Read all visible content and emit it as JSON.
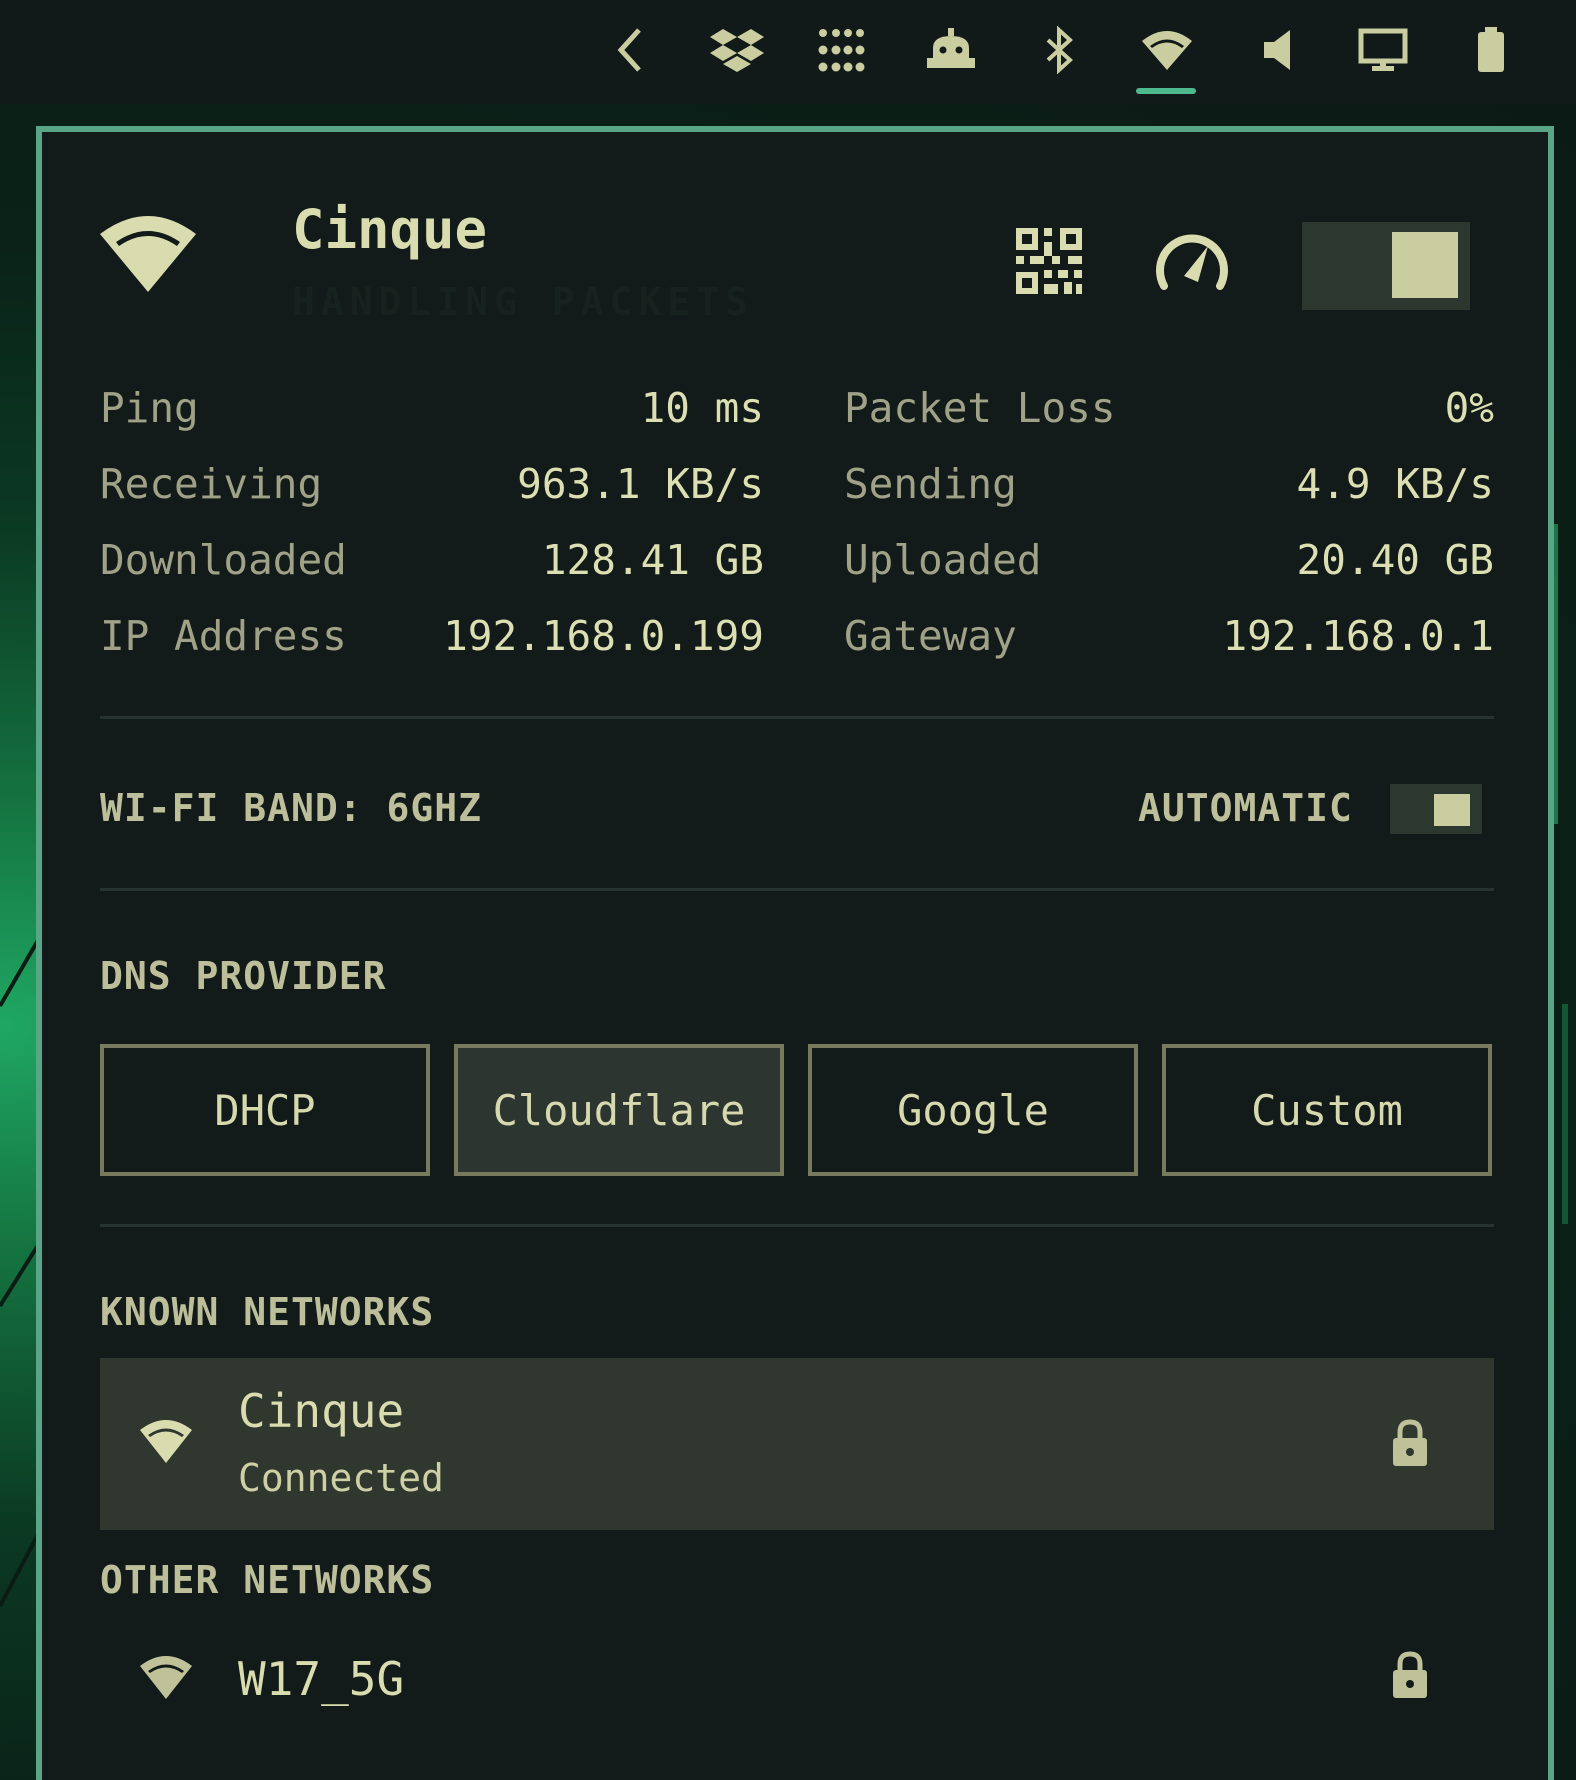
{
  "topbar": {
    "icons": [
      "chevron-left-icon",
      "dropbox-icon",
      "apps-grid-icon",
      "robot-icon",
      "bluetooth-icon",
      "wifi-icon",
      "volume-icon",
      "display-icon",
      "battery-icon"
    ],
    "active": "wifi-icon"
  },
  "header": {
    "network_name": "Cinque",
    "status_text": "HANDLING PACKETS",
    "toggle_on": true
  },
  "stats": {
    "left": [
      {
        "label": "Ping",
        "value": "10 ms"
      },
      {
        "label": "Receiving",
        "value": "963.1 KB/s"
      },
      {
        "label": "Downloaded",
        "value": "128.41 GB"
      },
      {
        "label": "IP Address",
        "value": "192.168.0.199"
      }
    ],
    "right": [
      {
        "label": "Packet Loss",
        "value": "0%"
      },
      {
        "label": "Sending",
        "value": "4.9 KB/s"
      },
      {
        "label": "Uploaded",
        "value": "20.40 GB"
      },
      {
        "label": "Gateway",
        "value": "192.168.0.1"
      }
    ]
  },
  "band": {
    "label": "WI-FI BAND: 6GHZ",
    "automatic_label": "AUTOMATIC",
    "automatic_on": true
  },
  "dns": {
    "section_label": "DNS PROVIDER",
    "options": [
      "DHCP",
      "Cloudflare",
      "Google",
      "Custom"
    ],
    "selected": "Cloudflare"
  },
  "known_networks": {
    "section_label": "KNOWN NETWORKS",
    "items": [
      {
        "name": "Cinque",
        "status": "Connected",
        "secured": true
      }
    ]
  },
  "other_networks": {
    "section_label": "OTHER NETWORKS",
    "items": [
      {
        "name": "W17_5G",
        "secured": true
      }
    ]
  },
  "colors": {
    "accent": "#5aa487",
    "text": "#d9dcae",
    "panel_bg": "#121b19",
    "selected_bg": "#2f372f"
  }
}
